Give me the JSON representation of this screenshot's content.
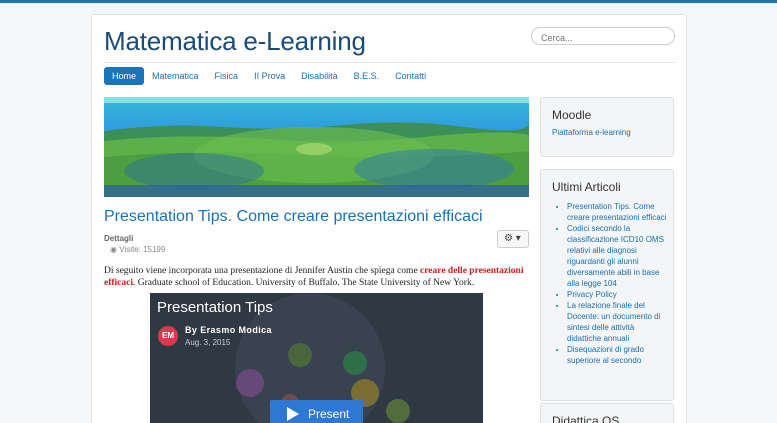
{
  "site": {
    "title": "Matematica e-Learning",
    "search_placeholder": "Cerca..."
  },
  "nav": {
    "items": [
      {
        "label": "Home",
        "active": true
      },
      {
        "label": "Matematica"
      },
      {
        "label": "Fisica"
      },
      {
        "label": "II Prova"
      },
      {
        "label": "Disabilità"
      },
      {
        "label": "B.E.S."
      },
      {
        "label": "Contatti"
      }
    ]
  },
  "article": {
    "title": "Presentation Tips. Come creare presentazioni efficaci",
    "details_label": "Dettagli",
    "visits_label": "Visite: 15199",
    "body_intro": "Di seguito viene incorporata una presentazione di Jennifer Austin che spiega come ",
    "body_highlight": "creare delle presentazioni efficaci",
    "body_rest": ". Graduate school of Education. University of Buffalo. The State University of New York.",
    "video": {
      "title": "Presentation Tips",
      "avatar_initials": "EM",
      "author": "By Erasmo Modica",
      "date": "Aug. 3, 2015",
      "present_label": "Present"
    }
  },
  "sidebar": {
    "moodle": {
      "heading": "Moodle",
      "link": "Piattaforma e-learning"
    },
    "ultimi": {
      "heading": "Ultimi Articoli",
      "items": [
        "Presentation Tips. Come creare presentazioni efficaci",
        "Codici secondo la classificazione ICD10 OMS relativi alle diagnosi riguardanti gli alunni diversamente abili in base alla legge 104",
        "Privacy Policy",
        "La relazione finale del Docente: un documento di sintesi delle attività didattiche annuali",
        "Disequazioni di grado superiore al secondo"
      ]
    },
    "didattica": {
      "heading": "Didattica OS"
    }
  },
  "colors": {
    "brand": "#1a74b8",
    "title": "#1a4a78",
    "link": "#1a6fb5",
    "highlight": "#d01c1c"
  }
}
